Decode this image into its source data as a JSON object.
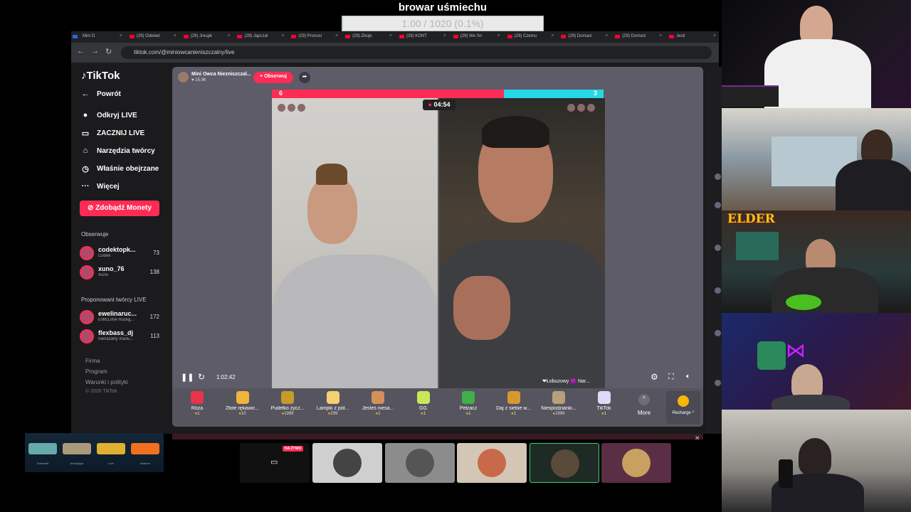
{
  "overlay": {
    "goal_title": "browar uśmiechu",
    "goal_progress_text": "1.00 / 1020 (0.1%)",
    "goal_progress_fraction": 0.001
  },
  "browser": {
    "tabs": [
      "Mini O",
      "(29) Odwied",
      "(29) Jreupk",
      "(29) Japczal",
      "(29) Pronosi",
      "(29) Zboje",
      "(29) KONT",
      "(29) We Sn",
      "(29) Czemu",
      "(29) Domani",
      "(29) Domani",
      "Jesti"
    ],
    "url": "tiktok.com/@miniowcanieniszczalny/live",
    "back_icon": "arrow-left-icon",
    "forward_icon": "arrow-right-icon",
    "reload_icon": "reload-icon"
  },
  "sidebar": {
    "logo": "TikTok",
    "nav": [
      {
        "label": "Powrót",
        "icon": "←"
      },
      {
        "label": "Odkryj LIVE",
        "icon": "●"
      },
      {
        "label": "ZACZNIJ LIVE",
        "icon": "▭"
      },
      {
        "label": "Narzędzia twórcy",
        "icon": "⌂"
      },
      {
        "label": "Właśnie obejrzane",
        "icon": "◷"
      },
      {
        "label": "Więcej",
        "icon": "···"
      }
    ],
    "coins_button": "Zdobądź Monety",
    "following_title": "Obserwuje",
    "following": [
      {
        "name": "codektopk...",
        "sub": "Codek",
        "count": "73"
      },
      {
        "name": "xuno_76",
        "sub": "Xuno",
        "count": "138"
      }
    ],
    "suggested_title": "Proponowani twórcy LIVE",
    "suggested": [
      {
        "name": "ewelinaruc...",
        "sub": "EWELINA Ruckg...",
        "count": "172"
      },
      {
        "name": "flexbass_dj",
        "sub": "nienażarty mariu...",
        "count": "113"
      }
    ],
    "footer": [
      "Firma",
      "Program",
      "Warunki i polityki",
      "© 2026 TikTok"
    ]
  },
  "stream": {
    "host_name": "Mini Owca Niezniszczal...",
    "host_likes": "♥ 25.9K",
    "follow_label": "+ Obserwuj",
    "score_left": "6",
    "score_right": "3",
    "battle_left_fraction": 0.7,
    "timer": "04:54",
    "right_caption": "❤Łobuzowy 😈 Nar...",
    "time_elapsed": "1:02:42",
    "colors": {
      "pink": "#fe2c55",
      "cyan": "#25d7e7"
    }
  },
  "gifts": [
    {
      "name": "Róża",
      "price": "1",
      "color": "#e8334a"
    },
    {
      "name": "Złote rękawic...",
      "price": "10",
      "color": "#f0b43a"
    },
    {
      "name": "Pudełko życz...",
      "price": "1999",
      "color": "#c89a2a"
    },
    {
      "name": "Lampki z pół...",
      "price": "299",
      "color": "#f5d070"
    },
    {
      "name": "Jesteś niesa...",
      "price": "1",
      "color": "#d4905a"
    },
    {
      "name": "GG",
      "price": "1",
      "color": "#c8e85a"
    },
    {
      "name": "Pełzacz",
      "price": "1",
      "color": "#3fb04a"
    },
    {
      "name": "Daj z siebie w...",
      "price": "1",
      "color": "#d89830"
    },
    {
      "name": "Niespodzianki...",
      "price": "2999",
      "color": "#b8a07a"
    },
    {
      "name": "TikTok",
      "price": "1",
      "color": "#e0d8f8"
    }
  ],
  "gift_more_label": "More",
  "recharge_label": "Recharge ^",
  "cams": {
    "elder_logo": "ELDER"
  },
  "skins": [
    {
      "name": "Karambit",
      "color": "#6aa"
    },
    {
      "name": "Nova|Appr",
      "color": "#aa9a7a"
    },
    {
      "name": "Lore",
      "color": "#e0b030"
    },
    {
      "name": "Asiimov",
      "color": "#f07020"
    }
  ],
  "thumbnails": {
    "live_badge": "NA ŻYWO"
  }
}
